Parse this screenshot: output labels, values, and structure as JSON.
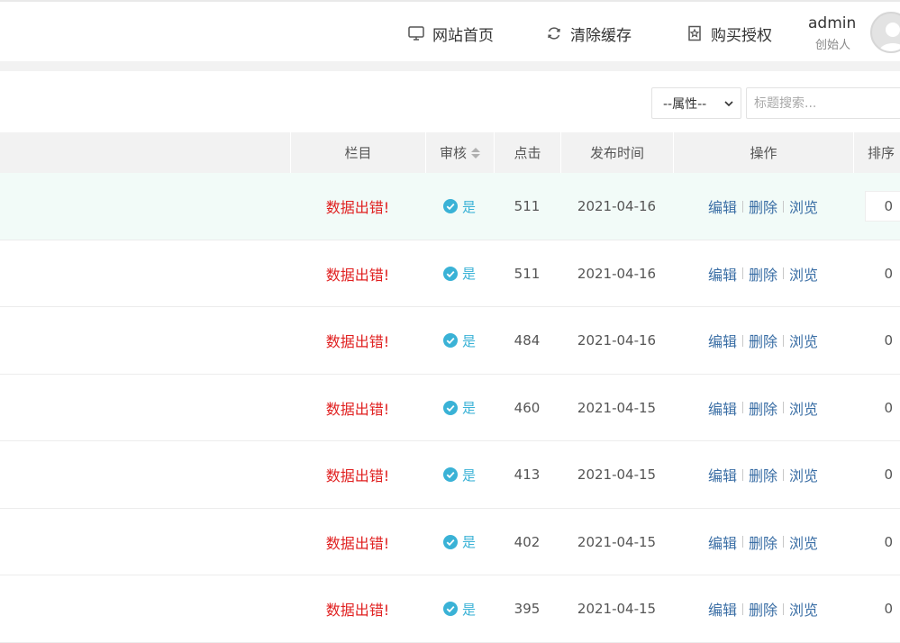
{
  "header": {
    "nav": [
      {
        "label": "网站首页",
        "icon": "monitor-icon"
      },
      {
        "label": "清除缓存",
        "icon": "refresh-icon"
      },
      {
        "label": "购买授权",
        "icon": "badge-star-icon"
      }
    ],
    "user": {
      "name": "admin",
      "role": "创始人"
    }
  },
  "filters": {
    "attribute_select": "--属性--",
    "search_placeholder": "标题搜索..."
  },
  "table": {
    "columns": {
      "category": "栏目",
      "audit": "审核",
      "clicks": "点击",
      "date": "发布时间",
      "actions": "操作",
      "sort": "排序"
    },
    "actions": {
      "edit": "编辑",
      "delete": "删除",
      "view": "浏览"
    },
    "rows": [
      {
        "category": "数据出错!",
        "audit": "是",
        "clicks": "511",
        "date": "2021-04-16",
        "sort": "0"
      },
      {
        "category": "数据出错!",
        "audit": "是",
        "clicks": "511",
        "date": "2021-04-16",
        "sort": "0"
      },
      {
        "category": "数据出错!",
        "audit": "是",
        "clicks": "484",
        "date": "2021-04-16",
        "sort": "0"
      },
      {
        "category": "数据出错!",
        "audit": "是",
        "clicks": "460",
        "date": "2021-04-15",
        "sort": "0"
      },
      {
        "category": "数据出错!",
        "audit": "是",
        "clicks": "413",
        "date": "2021-04-15",
        "sort": "0"
      },
      {
        "category": "数据出错!",
        "audit": "是",
        "clicks": "402",
        "date": "2021-04-15",
        "sort": "0"
      },
      {
        "category": "数据出错!",
        "audit": "是",
        "clicks": "395",
        "date": "2021-04-15",
        "sort": "0"
      }
    ]
  },
  "colors": {
    "error_text": "#e02020",
    "audit_ok": "#3ab2d6",
    "action_link": "#3a6ea5",
    "highlight_row": "#f2fbf8"
  }
}
